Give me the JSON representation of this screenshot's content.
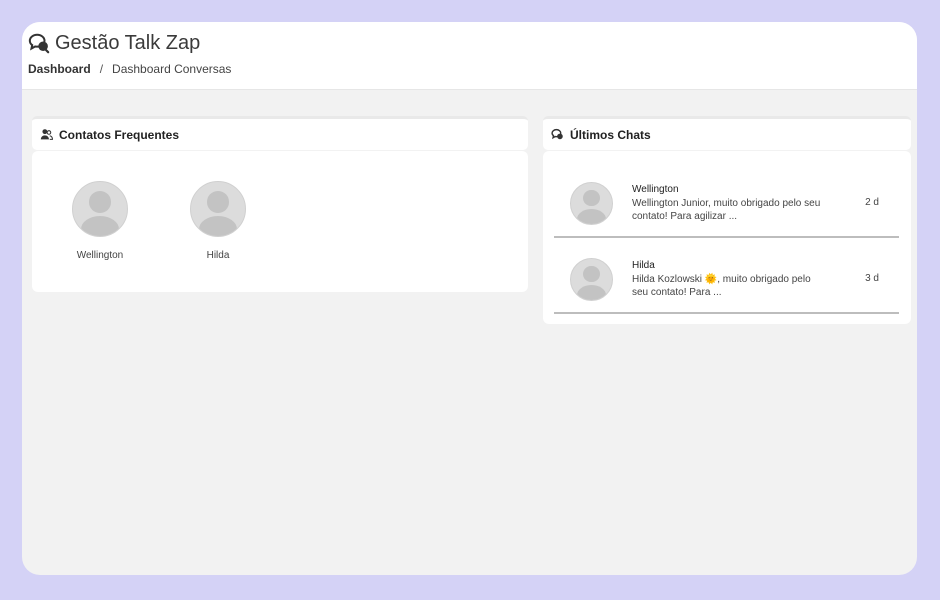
{
  "app": {
    "title": "Gestão Talk Zap",
    "icon": "chat-bubbles-icon"
  },
  "breadcrumb": {
    "root": "Dashboard",
    "separator": "/",
    "current": "Dashboard Conversas"
  },
  "frequent_contacts": {
    "title": "Contatos Frequentes",
    "icon": "users-icon",
    "contacts": [
      {
        "name": "Wellington"
      },
      {
        "name": "Hilda"
      }
    ]
  },
  "recent_chats": {
    "title": "Últimos Chats",
    "icon": "chat-bubbles-icon",
    "chats": [
      {
        "name": "Wellington",
        "message": "Wellington Junior, muito obrigado pelo seu contato! Para agilizar ...",
        "time": "2 d"
      },
      {
        "name": "Hilda",
        "message": "Hilda Kozlowski 🌞, muito obrigado pelo seu contato! Para ...",
        "time": "3 d"
      }
    ]
  },
  "colors": {
    "page_background": "#d4d2f6",
    "content_background": "#f2f2f2",
    "panel_background": "#ffffff",
    "avatar_placeholder": "#c3c3c3"
  }
}
